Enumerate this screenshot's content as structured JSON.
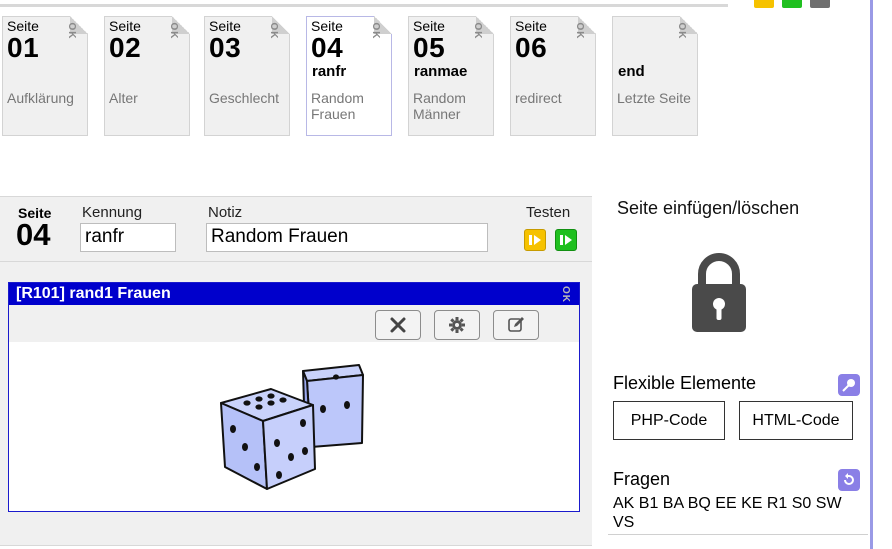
{
  "tabs": [
    {
      "label": "Seite",
      "num": "01",
      "ident": "",
      "title": "Aufklärung",
      "ok": "OK",
      "active": false
    },
    {
      "label": "Seite",
      "num": "02",
      "ident": "",
      "title": "Alter",
      "ok": "OK",
      "active": false
    },
    {
      "label": "Seite",
      "num": "03",
      "ident": "",
      "title": "Geschlecht",
      "ok": "OK",
      "active": false
    },
    {
      "label": "Seite",
      "num": "04",
      "ident": "ranfr",
      "title": "Random Frauen",
      "ok": "OK",
      "active": true
    },
    {
      "label": "Seite",
      "num": "05",
      "ident": "ranmae",
      "title": "Random Männer",
      "ok": "OK",
      "active": false
    },
    {
      "label": "Seite",
      "num": "06",
      "ident": "",
      "title": "redirect",
      "ok": "OK",
      "active": false
    },
    {
      "label": "",
      "num": "",
      "ident": "end",
      "title": "Letzte Seite",
      "ok": "OK",
      "active": false
    }
  ],
  "page_header": {
    "label": "Seite",
    "num": "04",
    "kennung_label": "Kennung",
    "kennung_value": "ranfr",
    "notiz_label": "Notiz",
    "notiz_value": "Random Frauen",
    "testen_label": "Testen"
  },
  "item": {
    "title": "[R101] rand1 Frauen",
    "ok": "OK"
  },
  "right_panel": {
    "title": "Seite einfügen/löschen",
    "flex_title": "Flexible Elemente",
    "php_button": "PHP-Code",
    "html_button": "HTML-Code",
    "fragen_title": "Fragen",
    "fragen_list": "AK B1 BA BQ EE KE R1 S0 SW VS"
  },
  "colors": {
    "accent_blue": "#0000cc",
    "test_yellow": "#f6c200",
    "test_green": "#20c020",
    "purple": "#8a7fe6"
  }
}
